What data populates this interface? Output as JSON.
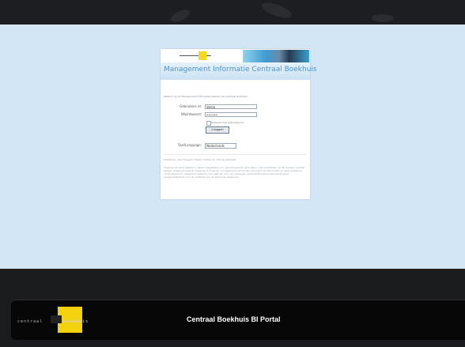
{
  "portal": {
    "title": "Centraal Boekhuis BI Portal",
    "brand_left": "centraal",
    "brand_right": "boekhuis"
  },
  "login": {
    "banner_title": "Management Informatie Centraal Boekhuis",
    "intro": "Welkom op de Management Informatie website van Centraal Boekhuis.",
    "gebruiker_label": "Gebruikers id:",
    "gebruiker_value": "demo",
    "wachtwoord_label": "Wachtwoord:",
    "wachtwoord_value": "••••••",
    "remember_label": "Onthoud mijn gebruikers id",
    "login_button": "Inloggen",
    "language_label": "Taal/Language:",
    "language_value": "Nederlands",
    "help_text": "Problemen met inloggen? Neem contact op met de helpdesk.",
    "disclaimer": "Toegang tot deze website is alleen toegestaan voor geautoriseerde gebruikers. Alle activiteiten op dit systeem worden gelogd. Ongeautoriseerde toegang of misbruik van gegevens zal worden vervolgd. De informatie op deze website is vertrouwelijk en uitsluitend bestemd voor gebruik door de ontvanger. Centraal Boekhuis aanvaardt geen aansprakelijkheid voor de juistheid van de getoonde gegevens."
  }
}
